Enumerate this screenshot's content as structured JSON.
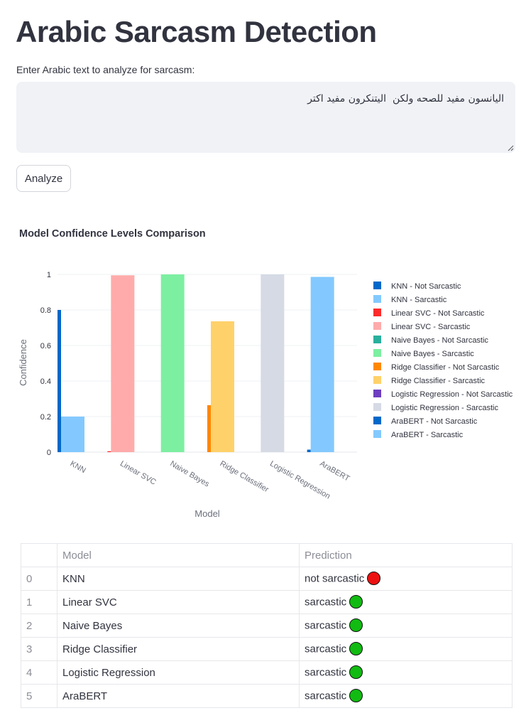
{
  "app": {
    "title": "Arabic Sarcasm Detection",
    "input_label": "Enter Arabic text to analyze for sarcasm:",
    "input_value": "اليانسون مفيد للصحه ولكن  اليتنكرون مفيد اكتر",
    "analyze_label": "Analyze"
  },
  "chart": {
    "title": "Model Confidence Levels Comparison"
  },
  "chart_data": {
    "type": "bar",
    "title": "Model Confidence Levels Comparison",
    "xlabel": "Model",
    "ylabel": "Confidence",
    "ylim": [
      0,
      1
    ],
    "yticks": [
      {
        "value": 0,
        "label": "0"
      },
      {
        "value": 0.2,
        "label": "0.2"
      },
      {
        "value": 0.4,
        "label": "0.4"
      },
      {
        "value": 0.6,
        "label": "0.6"
      },
      {
        "value": 0.8,
        "label": "0.8"
      },
      {
        "value": 1,
        "label": "1"
      }
    ],
    "grid": true,
    "legend_position": "right",
    "categories": [
      "KNN",
      "Linear SVC",
      "Naive Bayes",
      "Ridge Classifier",
      "Logistic Regression",
      "AraBERT"
    ],
    "series": [
      {
        "name": "KNN - Not Sarcastic",
        "category": "KNN",
        "value": 0.8,
        "color": "#0068c9"
      },
      {
        "name": "KNN - Sarcastic",
        "category": "KNN",
        "value": 0.2,
        "color": "#83c9ff"
      },
      {
        "name": "Linear SVC - Not Sarcastic",
        "category": "Linear SVC",
        "value": 0.005,
        "color": "#ff2b2b"
      },
      {
        "name": "Linear SVC - Sarcastic",
        "category": "Linear SVC",
        "value": 0.995,
        "color": "#ffabab"
      },
      {
        "name": "Naive Bayes - Not Sarcastic",
        "category": "Naive Bayes",
        "value": 0.0,
        "color": "#29b09d"
      },
      {
        "name": "Naive Bayes - Sarcastic",
        "category": "Naive Bayes",
        "value": 1.0,
        "color": "#7defa1"
      },
      {
        "name": "Ridge Classifier - Not Sarcastic",
        "category": "Ridge Classifier",
        "value": 0.264,
        "color": "#ff8700"
      },
      {
        "name": "Ridge Classifier - Sarcastic",
        "category": "Ridge Classifier",
        "value": 0.736,
        "color": "#ffd16a"
      },
      {
        "name": "Logistic Regression - Not Sarcastic",
        "category": "Logistic Regression",
        "value": 0.0,
        "color": "#6d3fc0"
      },
      {
        "name": "Logistic Regression - Sarcastic",
        "category": "Logistic Regression",
        "value": 1.0,
        "color": "#d5dae5"
      },
      {
        "name": "AraBERT - Not Sarcastic",
        "category": "AraBERT",
        "value": 0.014,
        "color": "#0068c9"
      },
      {
        "name": "AraBERT - Sarcastic",
        "category": "AraBERT",
        "value": 0.986,
        "color": "#83c9ff"
      }
    ]
  },
  "table": {
    "columns": [
      "",
      "Model",
      "Prediction"
    ],
    "rows": [
      {
        "index": "0",
        "model": "KNN",
        "prediction": "not sarcastic",
        "dot_color": "#ee1111"
      },
      {
        "index": "1",
        "model": "Linear SVC",
        "prediction": "sarcastic",
        "dot_color": "#11bb11"
      },
      {
        "index": "2",
        "model": "Naive Bayes",
        "prediction": "sarcastic",
        "dot_color": "#11bb11"
      },
      {
        "index": "3",
        "model": "Ridge Classifier",
        "prediction": "sarcastic",
        "dot_color": "#11bb11"
      },
      {
        "index": "4",
        "model": "Logistic Regression",
        "prediction": "sarcastic",
        "dot_color": "#11bb11"
      },
      {
        "index": "5",
        "model": "AraBERT",
        "prediction": "sarcastic",
        "dot_color": "#11bb11"
      }
    ]
  }
}
